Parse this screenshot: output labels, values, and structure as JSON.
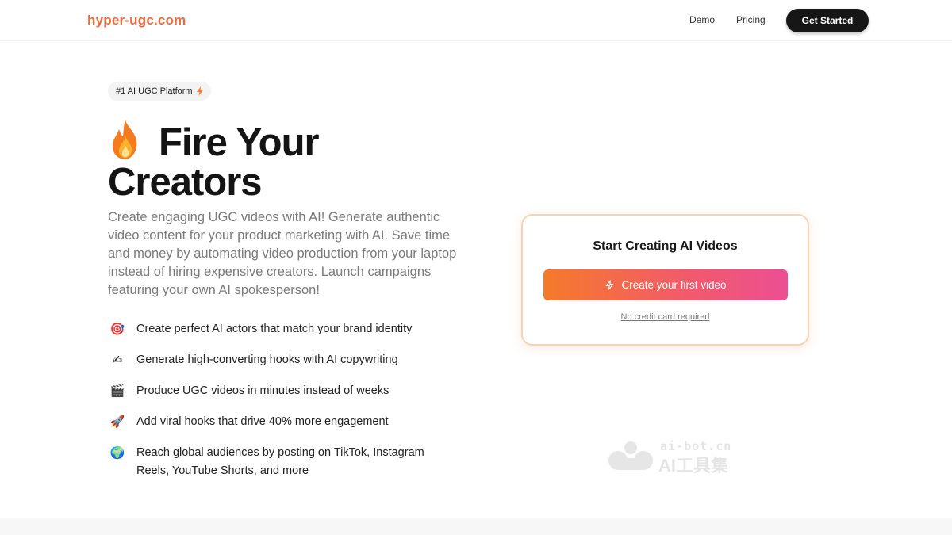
{
  "nav": {
    "logo": "hyper-ugc.com",
    "links": [
      "Demo",
      "Pricing"
    ],
    "cta": "Get Started"
  },
  "hero": {
    "badge": "#1 AI UGC Platform",
    "badge_icon": "lightning-bolt-icon",
    "title_icon": "fire-icon",
    "title_line1": "Fire Your",
    "title_line2": "Creators",
    "subtext": "Create engaging UGC videos with AI! Generate authentic video content for your product marketing with AI. Save time and money by automating video production from your laptop instead of hiring expensive creators. Launch campaigns featuring your own AI spokesperson!",
    "features": [
      {
        "icon": "target-icon",
        "glyph": "🎯",
        "text": "Create perfect AI actors that match your brand identity"
      },
      {
        "icon": "writing-hand-icon",
        "glyph": "✍",
        "text": "Generate high-converting hooks with AI copywriting"
      },
      {
        "icon": "clapper-board-icon",
        "glyph": "🎬",
        "text": "Produce UGC videos in minutes instead of weeks"
      },
      {
        "icon": "rocket-icon",
        "glyph": "🚀",
        "text": "Add viral hooks that drive 40% more engagement"
      },
      {
        "icon": "globe-icon",
        "glyph": "🌍",
        "text": "Reach global audiences by posting on TikTok, Instagram Reels, YouTube Shorts, and more"
      }
    ]
  },
  "card": {
    "title": "Start Creating AI Videos",
    "button": "Create your first video",
    "button_icon": "sparkle-icon",
    "note": "No credit card required"
  },
  "watermark": {
    "top": "ai-bot.cn",
    "bottom": "AI工具集"
  },
  "colors": {
    "brand": "#f06a3c",
    "gradient_start": "#f57a2a",
    "gradient_end": "#ec4f93",
    "dark_button": "#161616"
  }
}
